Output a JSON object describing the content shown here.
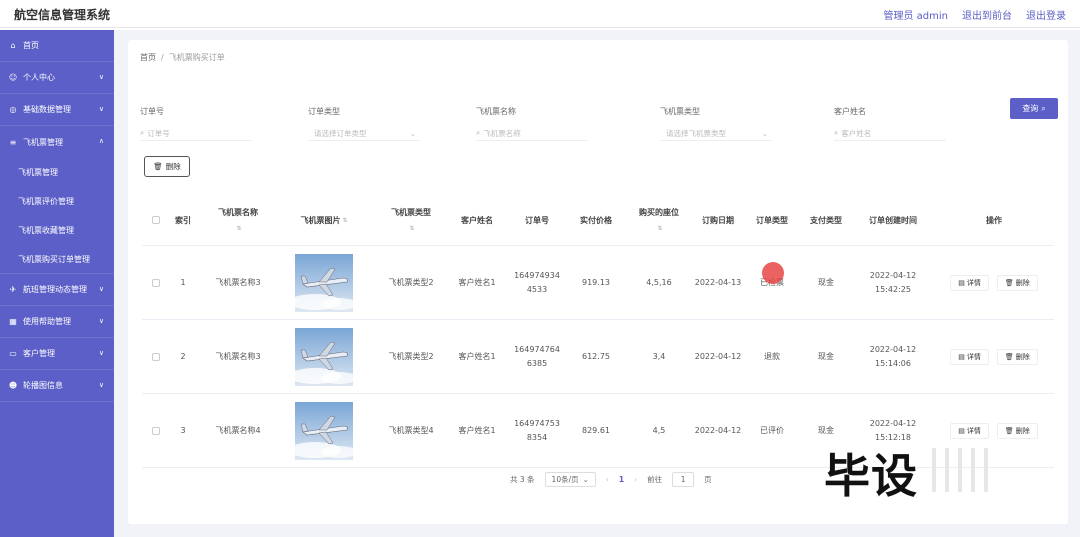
{
  "app": {
    "title": "航空信息管理系统"
  },
  "top_links": {
    "admin": "管理员 admin",
    "front": "退出到前台",
    "logout": "退出登录"
  },
  "sidebar": {
    "home": "首页",
    "personal": "个人中心",
    "basic_data": "基础数据管理",
    "ticket_mgmt": "飞机票管理",
    "sub": {
      "ticket": "飞机票管理",
      "review": "飞机票评价管理",
      "favorite": "飞机票收藏管理",
      "order": "飞机票购买订单管理"
    },
    "flight_dynamic": "航班管理动态管理",
    "help": "使用帮助管理",
    "customer": "客户管理",
    "carousel": "轮播图信息"
  },
  "breadcrumb": {
    "home": "首页",
    "sep": "/",
    "current": "飞机票购买订单"
  },
  "filters": {
    "order_no": {
      "label": "订单号",
      "placeholder": "订单号"
    },
    "order_type": {
      "label": "订单类型",
      "placeholder": "请选择订单类型"
    },
    "ticket_name": {
      "label": "飞机票名称",
      "placeholder": "飞机票名称"
    },
    "ticket_type": {
      "label": "飞机票类型",
      "placeholder": "请选择飞机票类型"
    },
    "customer_name": {
      "label": "客户姓名",
      "placeholder": "客户姓名"
    }
  },
  "buttons": {
    "query": "查询",
    "delete": "删除"
  },
  "table": {
    "headers": {
      "index": "索引",
      "name": "飞机票名称",
      "image": "飞机票图片",
      "type": "飞机票类型",
      "customer": "客户姓名",
      "order_no": "订单号",
      "price": "实付价格",
      "seats": "购买的座位",
      "date": "订购日期",
      "order_type": "订单类型",
      "pay_type": "支付类型",
      "created": "订单创建时间",
      "actions": "操作"
    },
    "row_actions": {
      "detail": "详情",
      "delete": "删除"
    },
    "rows": [
      {
        "index": "1",
        "name": "飞机票名称3",
        "type": "飞机票类型2",
        "customer": "客户姓名1",
        "order_no_1": "164974934",
        "order_no_2": "4533",
        "price": "919.13",
        "seats": "4,5,16",
        "date": "2022-04-13",
        "order_type": "已检票",
        "pay_type": "现金",
        "created_date": "2022-04-12",
        "created_time": "15:42:25"
      },
      {
        "index": "2",
        "name": "飞机票名称3",
        "type": "飞机票类型2",
        "customer": "客户姓名1",
        "order_no_1": "164974764",
        "order_no_2": "6385",
        "price": "612.75",
        "seats": "3,4",
        "date": "2022-04-12",
        "order_type": "退款",
        "pay_type": "现金",
        "created_date": "2022-04-12",
        "created_time": "15:14:06"
      },
      {
        "index": "3",
        "name": "飞机票名称4",
        "type": "飞机票类型4",
        "customer": "客户姓名1",
        "order_no_1": "164974753",
        "order_no_2": "8354",
        "price": "829.61",
        "seats": "4,5",
        "date": "2022-04-12",
        "order_type": "已评价",
        "pay_type": "现金",
        "created_date": "2022-04-12",
        "created_time": "15:12:18"
      }
    ]
  },
  "pagination": {
    "total": "共 3 条",
    "page_size": "10条/页",
    "current": "1",
    "goto": "前往",
    "goto_value": "1",
    "page_unit": "页"
  },
  "watermark": "毕设",
  "colors": {
    "primary": "#5b5fc7"
  }
}
